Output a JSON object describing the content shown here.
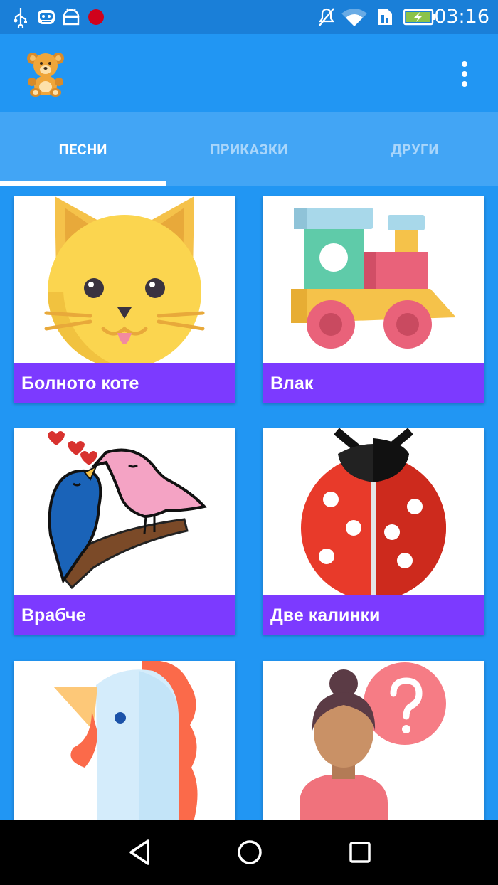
{
  "status_bar": {
    "time": "03:16",
    "icons": [
      "usb-icon",
      "robot-face-icon",
      "android-icon",
      "record-dot-icon",
      "mute-icon",
      "wifi-icon",
      "sim-icon",
      "battery-charging-icon"
    ]
  },
  "app_bar": {
    "logo_icon": "teddy-bear-icon",
    "menu_icon": "more-vert-icon"
  },
  "tabs": [
    {
      "label": "ПЕСНИ",
      "active": true
    },
    {
      "label": "ПРИКАЗКИ",
      "active": false
    },
    {
      "label": "ДРУГИ",
      "active": false
    }
  ],
  "cards": [
    {
      "title": "Болното коте",
      "image": "cat-icon"
    },
    {
      "title": "Влак",
      "image": "toy-train-icon"
    },
    {
      "title": "Врабче",
      "image": "birds-icon"
    },
    {
      "title": "Две калинки",
      "image": "ladybug-icon"
    },
    {
      "title": "",
      "image": "rooster-icon"
    },
    {
      "title": "",
      "image": "girl-question-icon"
    }
  ],
  "nav_bar": {
    "back": "back-triangle-icon",
    "home": "home-circle-icon",
    "recents": "recents-square-icon"
  },
  "colors": {
    "primary": "#2196f3",
    "status_bar": "#1a7fd8",
    "tab_bar": "#42a5f5",
    "card_caption": "#7c3aff"
  }
}
